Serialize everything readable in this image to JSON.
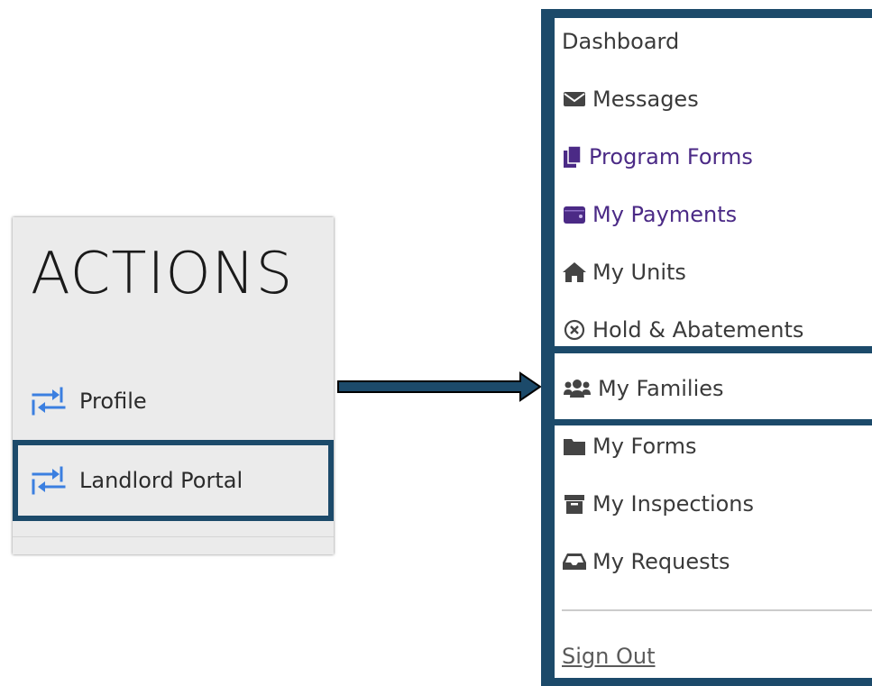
{
  "actions": {
    "title": "ACTIONS",
    "items": [
      {
        "label": "Profile",
        "icon": "swap-arrows-icon"
      },
      {
        "label": "Landlord Portal",
        "icon": "swap-arrows-icon"
      }
    ]
  },
  "menu": {
    "items": [
      {
        "label": "Dashboard",
        "icon": ""
      },
      {
        "label": "Messages",
        "icon": "envelope-icon"
      },
      {
        "label": "Program Forms",
        "icon": "documents-icon"
      },
      {
        "label": "My Payments",
        "icon": "wallet-icon"
      },
      {
        "label": "My Units",
        "icon": "home-icon"
      },
      {
        "label": "Hold & Abatements",
        "icon": "circle-x-icon"
      },
      {
        "label": "My Families",
        "icon": "users-icon"
      },
      {
        "label": "My Forms",
        "icon": "folder-icon"
      },
      {
        "label": "My Inspections",
        "icon": "archive-icon"
      },
      {
        "label": "My Requests",
        "icon": "inbox-icon"
      }
    ],
    "sign_out": "Sign Out"
  },
  "colors": {
    "highlight_border": "#1c4a6a",
    "icon_blue": "#3b7fe0",
    "menu_purple": "#4b2a86",
    "menu_text": "#3a3a3a"
  }
}
